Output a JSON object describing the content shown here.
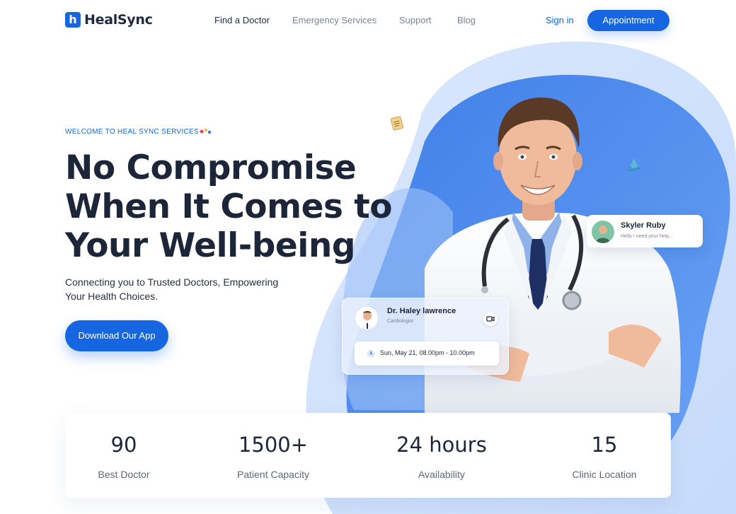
{
  "brand": {
    "logo_letter": "h",
    "name": "HealSync"
  },
  "nav": {
    "links": [
      {
        "label": "Find a Doctor"
      },
      {
        "label": "Emergency Services"
      },
      {
        "label": "Support"
      },
      {
        "label": "Blog"
      }
    ],
    "signin_label": "Sign in",
    "appointment_label": "Appointment"
  },
  "hero": {
    "welcome": "WELCOME TO HEAL SYNC SERVICES",
    "headline_lines": [
      "No Compromise",
      "When It Comes to",
      "Your Well-being"
    ],
    "subtext_lines": [
      "Connecting you to Trusted Doctors, Empowering",
      "Your Health Choices."
    ],
    "download_label": "Download Our App"
  },
  "chat_card": {
    "name": "Skyler Ruby",
    "message": "Hello I need your help..."
  },
  "doctor_card": {
    "name": "Dr. Haley lawrence",
    "role": "Cardiologist",
    "schedule": "Sun, May 21, 08.00pm - 10.00pm"
  },
  "stats": [
    {
      "value": "90",
      "label": "Best Doctor"
    },
    {
      "value": "1500+",
      "label": "Patient Capacity"
    },
    {
      "value": "24 hours",
      "label": "Availability"
    },
    {
      "value": "15",
      "label": "Clinic Location"
    }
  ],
  "colors": {
    "primary": "#1566e0",
    "heading": "#1c2638",
    "muted": "#7b8494",
    "blob": "#4f8ef0"
  }
}
